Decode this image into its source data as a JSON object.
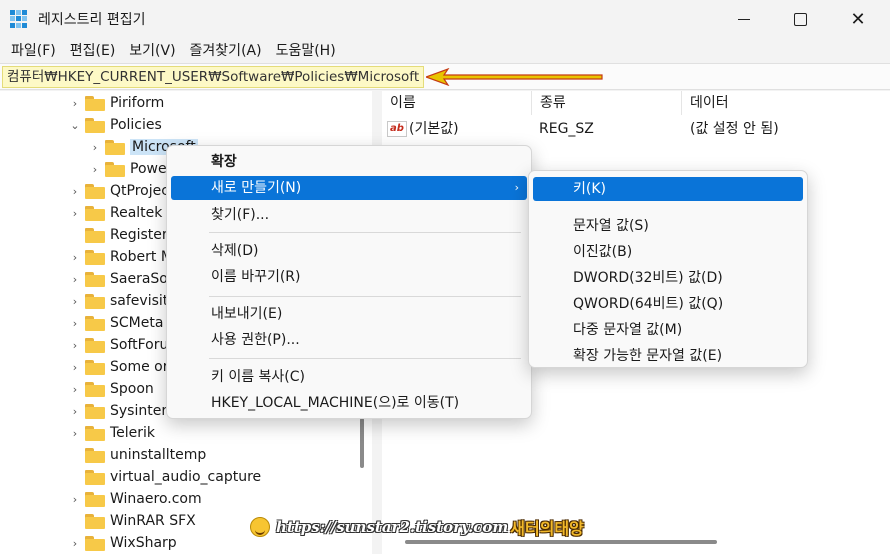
{
  "window": {
    "title": "레지스트리 편집기",
    "minimize_icon": "minimize-icon",
    "maximize_icon": "maximize-icon",
    "close_glyph": "✕"
  },
  "menubar": [
    "파일(F)",
    "편집(E)",
    "보기(V)",
    "즐겨찾기(A)",
    "도움말(H)"
  ],
  "address": {
    "path": "컴퓨터₩HKEY_CURRENT_USER₩Software₩Policies₩Microsoft",
    "highlight_color": "#fdf9c6",
    "annotation_arrow_color": "#e8c400"
  },
  "tree": {
    "items": [
      {
        "label": "Piriform",
        "chevron": "›"
      },
      {
        "label": "Policies",
        "chevron": "⌄"
      },
      {
        "label": "Microsoft",
        "chevron": "›"
      },
      {
        "label": "Powe",
        "chevron": "›"
      },
      {
        "label": "QtProjec",
        "chevron": "›"
      },
      {
        "label": "Realtek",
        "chevron": "›"
      },
      {
        "label": "Register",
        "chevron": ""
      },
      {
        "label": "Robert M",
        "chevron": "›"
      },
      {
        "label": "SaeraSo",
        "chevron": "›"
      },
      {
        "label": "safevisit",
        "chevron": "›"
      },
      {
        "label": "SCMeta",
        "chevron": "›"
      },
      {
        "label": "SoftForu",
        "chevron": "›"
      },
      {
        "label": "Some or",
        "chevron": "›"
      },
      {
        "label": "Spoon",
        "chevron": "›"
      },
      {
        "label": "Sysinter",
        "chevron": "›"
      },
      {
        "label": "Telerik",
        "chevron": "›"
      },
      {
        "label": "uninstalltemp",
        "chevron": ""
      },
      {
        "label": "virtual_audio_capture",
        "chevron": ""
      },
      {
        "label": "Winaero.com",
        "chevron": "›"
      },
      {
        "label": "WinRAR SFX",
        "chevron": ""
      },
      {
        "label": "WixSharp",
        "chevron": "›"
      }
    ]
  },
  "list": {
    "columns": [
      "이름",
      "종류",
      "데이터"
    ],
    "rows": [
      {
        "icon": "string-value-icon",
        "icon_text": "ab",
        "name": "(기본값)",
        "type": "REG_SZ",
        "data": "(값 설정 안 됨)"
      }
    ]
  },
  "context_menu": {
    "items": [
      {
        "label": "확장",
        "bold": true
      },
      {
        "label": "새로 만들기(N)",
        "highlighted": true,
        "submenu_arrow": "›"
      },
      {
        "label": "찾기(F)..."
      },
      {
        "label": "삭제(D)"
      },
      {
        "label": "이름 바꾸기(R)"
      },
      {
        "label": "내보내기(E)"
      },
      {
        "label": "사용 권한(P)..."
      },
      {
        "label": "키 이름 복사(C)"
      },
      {
        "label": "HKEY_LOCAL_MACHINE(으)로 이동(T)"
      }
    ],
    "highlight_color": "#0a74d8"
  },
  "submenu": {
    "items": [
      {
        "label": "키(K)",
        "highlighted": true
      },
      {
        "label": "문자열 값(S)"
      },
      {
        "label": "이진값(B)"
      },
      {
        "label": "DWORD(32비트) 값(D)"
      },
      {
        "label": "QWORD(64비트) 값(Q)"
      },
      {
        "label": "다중 문자열 값(M)"
      },
      {
        "label": "확장 가능한 문자열 값(E)"
      }
    ]
  },
  "watermark": {
    "url": "https://sunstar2.tistory.com",
    "brand": "새터의태양",
    "icon": "smiley-face-icon"
  }
}
